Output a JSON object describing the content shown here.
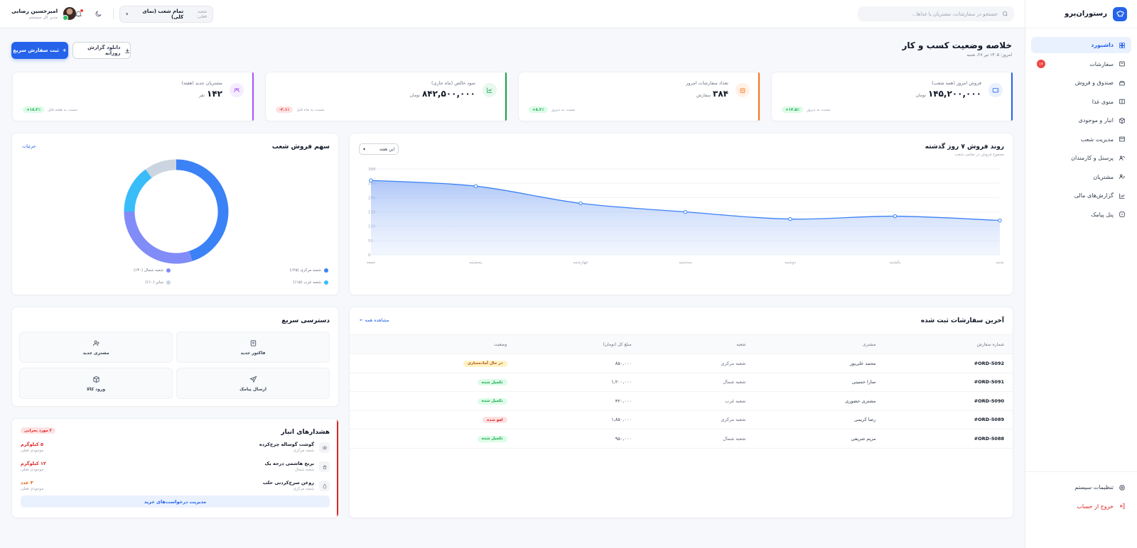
{
  "brand": {
    "name": "رستوران‌پرو"
  },
  "nav": [
    {
      "label": "داشبورد",
      "icon": "dashboard-icon",
      "active": true
    },
    {
      "label": "سفارشات",
      "icon": "orders-icon",
      "badge": "۱۲"
    },
    {
      "label": "صندوق و فروش",
      "icon": "cash-register-icon"
    },
    {
      "label": "منوی غذا",
      "icon": "menu-book-icon"
    },
    {
      "label": "انبار و موجودی",
      "icon": "box-icon"
    },
    {
      "label": "مدیریت شعب",
      "icon": "store-icon"
    },
    {
      "label": "پرسنل و کارمندان",
      "icon": "staff-icon"
    },
    {
      "label": "مشتریان",
      "icon": "customers-icon"
    },
    {
      "label": "گزارش‌های مالی",
      "icon": "chart-icon"
    },
    {
      "label": "پنل پیامک",
      "icon": "sms-icon"
    }
  ],
  "sidebar_bottom": {
    "settings": "تنظیمات سیستم",
    "logout": "خروج از حساب"
  },
  "topbar": {
    "search_placeholder": "جستجو در سفارشات، مشتریان یا غذاها...",
    "branch_label": "شعبه فعلی:",
    "branch_value": "تمام شعب (نمای کلی)",
    "user_name": "امیرحسین رضایی",
    "user_role": "مدیر کل سیستم"
  },
  "header": {
    "title": "خلاصه وضعیت کسب و کار",
    "date": "امروز: ۱۴۰۵ تیر ۲۷، شنبه",
    "primary_btn": "ثبت سفارش سریع",
    "download_btn": "دانلود گزارش روزانه"
  },
  "stats": [
    {
      "label": "فروش امروز (همه شعب)",
      "value": "۱۴۵,۲۰۰,۰۰۰",
      "unit": "تومان",
      "change": "۱۴.۵٪+",
      "trend": "up",
      "note": "نسبت به دیروز",
      "color": "#2563eb",
      "icon": "wallet-icon",
      "icon_bg": "#eaf1fe"
    },
    {
      "label": "تعداد سفارشات امروز",
      "value": "۳۸۴",
      "unit": "سفارش",
      "change": "۸.۲٪+",
      "trend": "up",
      "note": "نسبت به دیروز",
      "color": "#f97316",
      "icon": "shopping-bag-icon",
      "icon_bg": "#fff1e6"
    },
    {
      "label": "سود خالص (ماه جاری)",
      "value": "۸۴۲,۵۰۰,۰۰۰",
      "unit": "تومان",
      "change": "۲.۱٪-",
      "trend": "down",
      "note": "نسبت به ماه قبل",
      "color": "#16a34a",
      "icon": "trend-icon",
      "icon_bg": "#e7f8ee"
    },
    {
      "label": "مشتریان جدید (هفته)",
      "value": "۱۴۲",
      "unit": "نفر",
      "change": "۱۸.۲٪+",
      "trend": "up",
      "note": "نسبت به هفته قبل",
      "color": "#a855f7",
      "icon": "users-icon",
      "icon_bg": "#f5ecfe"
    }
  ],
  "sales_chart": {
    "title": "روند فروش ۷ روز گذشته",
    "subtitle": "مجموع فروش در تمامی شعب",
    "dropdown": "این هفته"
  },
  "chart_data": [
    {
      "type": "area",
      "title": "روند فروش ۷ روز گذشته",
      "categories": [
        "شنبه",
        "یکشنبه",
        "دوشنبه",
        "سه‌شنبه",
        "چهارشنبه",
        "پنجشنبه",
        "جمعه"
      ],
      "series": [
        {
          "values": [
            120,
            135,
            125,
            150,
            180,
            240,
            260
          ]
        }
      ],
      "yticks": [
        "0",
        "50",
        "100",
        "150",
        "200",
        "250",
        "300"
      ],
      "ylim": [
        0,
        300
      ],
      "x_direction": "right-to-left",
      "grid": true,
      "color": "#3b82f6"
    },
    {
      "type": "pie",
      "title": "سهم فروش شعب",
      "slices": [
        {
          "name": "شعبه مرکزی (۴۵٪)",
          "value": 45,
          "color": "#3b82f6"
        },
        {
          "name": "شعبه شمال (۳۰٪)",
          "value": 30,
          "color": "#818cf8"
        },
        {
          "name": "شعبه غرب (۱۵٪)",
          "value": 15,
          "color": "#38bdf8"
        },
        {
          "name": "سایر (۱۰٪)",
          "value": 10,
          "color": "#cbd5e1"
        }
      ]
    }
  ],
  "share_card": {
    "title": "سهم فروش شعب",
    "details": "جزئیات"
  },
  "orders": {
    "title": "آخرین سفارشات ثبت شده",
    "view_all": "مشاهده همه ←",
    "headers": [
      "شماره سفارش",
      "مشتری",
      "شعبه",
      "مبلغ کل (تومان)",
      "وضعیت"
    ],
    "rows": [
      {
        "id": "#ORD-5092",
        "customer": "محمد علی‌پور",
        "branch": "شعبه مرکزی",
        "amount": "۸۵۰,۰۰۰",
        "status": "در حال آماده‌سازی",
        "status_type": "y"
      },
      {
        "id": "#ORD-5091",
        "customer": "سارا حسینی",
        "branch": "شعبه شمال",
        "amount": "۱,۲۰۰,۰۰۰",
        "status": "تکمیل شده",
        "status_type": "g"
      },
      {
        "id": "#ORD-5090",
        "customer": "مشتری حضوری",
        "branch": "شعبه غرب",
        "amount": "۴۲۰,۰۰۰",
        "status": "تکمیل شده",
        "status_type": "g"
      },
      {
        "id": "#ORD-5089",
        "customer": "رضا کریمی",
        "branch": "شعبه مرکزی",
        "amount": "۱,۸۵۰,۰۰۰",
        "status": "لغو شده",
        "status_type": "r"
      },
      {
        "id": "#ORD-5088",
        "customer": "مریم شریفی",
        "branch": "شعبه شمال",
        "amount": "۹۵۰,۰۰۰",
        "status": "تکمیل شده",
        "status_type": "g"
      }
    ]
  },
  "quick_access": {
    "title": "دسترسی سریع",
    "items": [
      {
        "label": "فاکتور جدید",
        "icon": "invoice-icon"
      },
      {
        "label": "مشتری جدید",
        "icon": "user-add-icon"
      },
      {
        "label": "ارسال پیامک",
        "icon": "send-icon"
      },
      {
        "label": "ورود کالا",
        "icon": "package-icon"
      }
    ]
  },
  "inventory": {
    "title": "هشدارهای انبار",
    "badge": "۳ مورد بحرانی",
    "remaining_label": "موجودی فعلی",
    "items": [
      {
        "name": "گوشت گوساله چرخ‌کرده",
        "branch": "شعبه مرکزی",
        "qty": "۵ کیلوگرم",
        "qty_color": "#dc2626",
        "icon": "meat-icon"
      },
      {
        "name": "برنج هاشمی درجه یک",
        "branch": "شعبه شمال",
        "qty": "۱۲ کیلوگرم",
        "qty_color": "#dc2626",
        "icon": "rice-icon"
      },
      {
        "name": "روغن سرخ‌کردنی حلب",
        "branch": "شعبه مرکزی",
        "qty": "۳ عدد",
        "qty_color": "#ea580c",
        "icon": "oil-icon"
      }
    ],
    "button": "مدیریت درخواست‌های خرید"
  }
}
